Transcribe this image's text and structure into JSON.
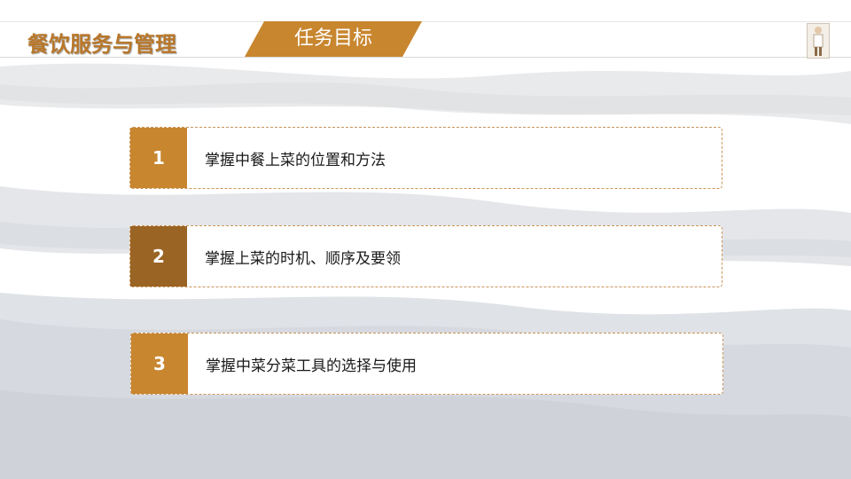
{
  "header": {
    "course_title": "餐饮服务与管理",
    "section_title": "任务目标"
  },
  "colors": {
    "accent": "#c8862f",
    "accent_dark": "#9a6424",
    "title": "#b8772a"
  },
  "objectives": [
    {
      "number": "1",
      "text": "掌握中餐上菜的位置和方法"
    },
    {
      "number": "2",
      "text": "掌握上菜的时机、顺序及要领"
    },
    {
      "number": "3",
      "text": "掌握中菜分菜工具的选择与使用"
    }
  ]
}
